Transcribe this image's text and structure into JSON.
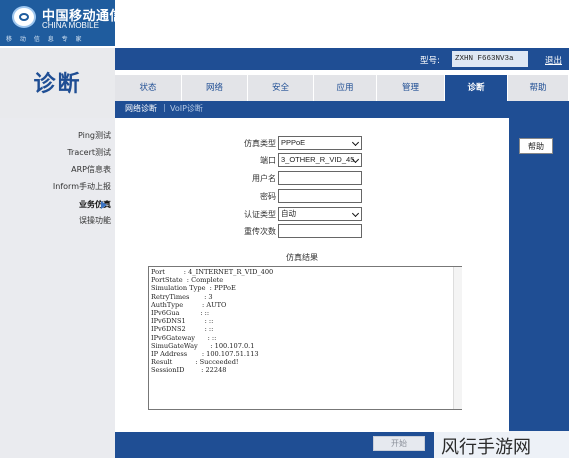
{
  "brand": {
    "name_cn": "中国移动通信",
    "name_en": "CHINA MOBILE",
    "slogan": "移 动 信 息 专 家"
  },
  "header": {
    "model_label": "型号:",
    "model_value": "ZXHN F663NV3a",
    "logout": "退出"
  },
  "page_title": "诊断",
  "tabs": [
    {
      "label": "状态",
      "active": false
    },
    {
      "label": "网络",
      "active": false
    },
    {
      "label": "安全",
      "active": false
    },
    {
      "label": "应用",
      "active": false
    },
    {
      "label": "管理",
      "active": false
    },
    {
      "label": "诊断",
      "active": true
    },
    {
      "label": "帮助",
      "active": false
    }
  ],
  "subtabs": {
    "network": "网络诊断",
    "divider": "|",
    "vdsl": "VoIP诊断"
  },
  "sidebar": {
    "items": [
      {
        "label": "Ping测试",
        "active": false
      },
      {
        "label": "Tracert测试",
        "active": false
      },
      {
        "label": "ARP信息表",
        "active": false
      },
      {
        "label": "Inform手动上报",
        "active": false
      },
      {
        "label": "业务仿真",
        "active": true
      },
      {
        "label": "误操功能",
        "active": false
      }
    ]
  },
  "help_button": "帮助",
  "form": {
    "sim_type": {
      "label": "仿真类型",
      "value": "PPPoE"
    },
    "port": {
      "label": "端口",
      "value": "3_OTHER_R_VID_45"
    },
    "username": {
      "label": "用户名",
      "value": ""
    },
    "password": {
      "label": "密码",
      "value": ""
    },
    "auth_type": {
      "label": "认证类型",
      "value": "自动"
    },
    "retry": {
      "label": "重传次数",
      "value": ""
    }
  },
  "result": {
    "title": "仿真结果",
    "lines": [
      "Port         : 4_INTERNET_R_VID_400",
      "PortState  : Complete",
      "Simulation Type  : PPPoE",
      "RetryTimes       : 3",
      "AuthType         : AUTO",
      "IPv6Gua          : ::",
      "IPv6DNS1         : ::",
      "IPv6DNS2         : ::",
      "IPv6Gateway      : ::",
      "SimuGateWay      : 100.107.0.1",
      "IP Address       : 100.107.51.113",
      "Result           : Succeeded!",
      "SessionID        : 22248"
    ]
  },
  "footer": {
    "start": "开始"
  },
  "watermark": "风行手游网",
  "colors": {
    "brand_blue": "#1f5c9e",
    "nav_blue": "#1f4e94",
    "sidebar_gray": "#eaebef"
  }
}
